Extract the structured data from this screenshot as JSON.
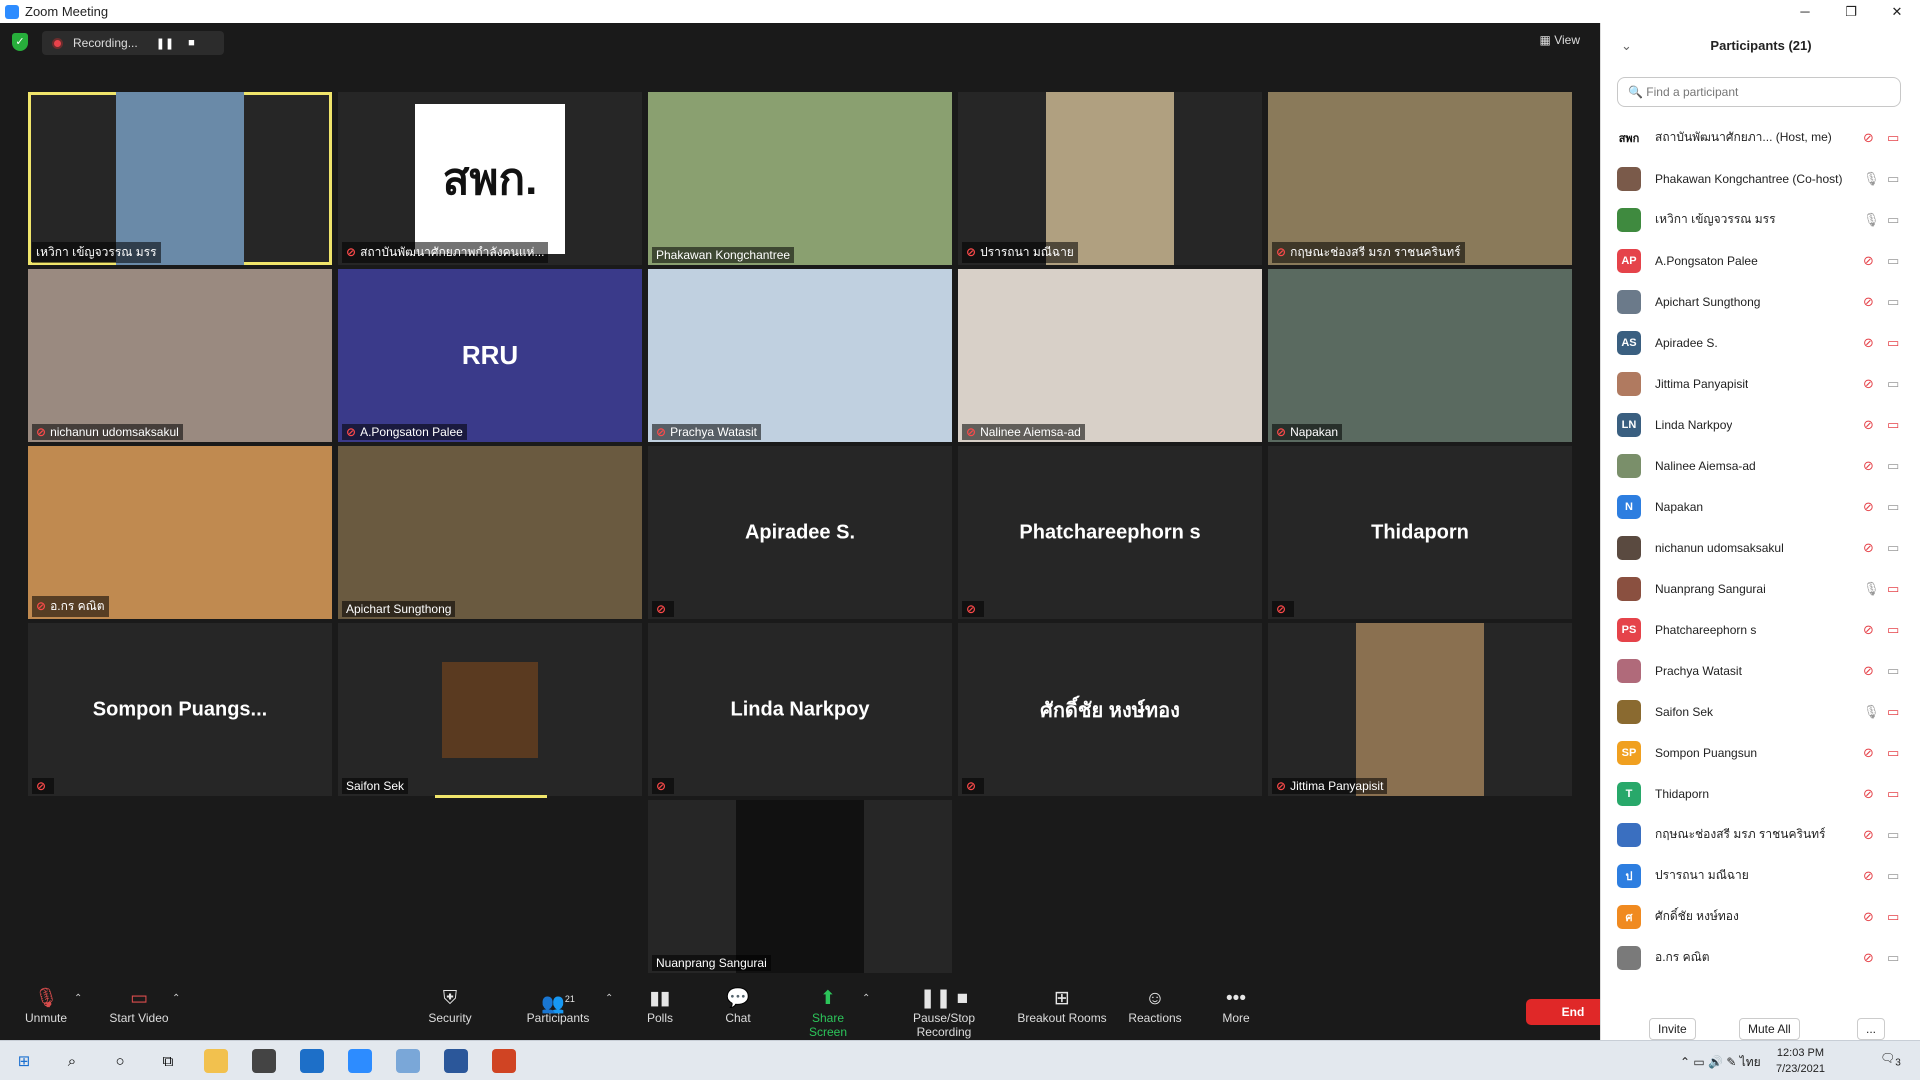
{
  "window": {
    "title": "Zoom Meeting",
    "minimize": "─",
    "restore": "❐",
    "close": "✕"
  },
  "topbar": {
    "recording_label": "Recording...",
    "pause_symbol": "❚❚",
    "stop_symbol": "■",
    "view_label": "View"
  },
  "tiles": [
    {
      "name": "เหวิกา เข้ญจวรรณ มรร",
      "muted": false,
      "video": true
    },
    {
      "name": "สถาบันพัฒนาศักยภาพกำลังคนแห่...",
      "muted": true,
      "video": true,
      "logo_text": "สพก."
    },
    {
      "name": "Phakawan Kongchantree",
      "muted": false,
      "video": true
    },
    {
      "name": "ปรารถนา มณีฉาย",
      "muted": true,
      "video": true
    },
    {
      "name": "กฤษณะช่องสรี มรภ ราชนครินทร์",
      "muted": true,
      "video": true
    },
    {
      "name": "nichanun udomsaksakul",
      "muted": true,
      "video": true
    },
    {
      "name": "A.Pongsaton Palee",
      "muted": true,
      "video": true,
      "logo_text": "RRU"
    },
    {
      "name": "Prachya Watasit",
      "muted": true,
      "video": true
    },
    {
      "name": "Nalinee Aiemsa-ad",
      "muted": true,
      "video": true
    },
    {
      "name": "Napakan",
      "muted": true,
      "video": true
    },
    {
      "name": "อ.กร คณิต",
      "muted": true,
      "video": true
    },
    {
      "name": "Apichart Sungthong",
      "muted": false,
      "video": true
    },
    {
      "name": "",
      "muted": true,
      "video": false,
      "big": "Apiradee S."
    },
    {
      "name": "",
      "muted": true,
      "video": false,
      "big": "Phatchareephorn s"
    },
    {
      "name": "",
      "muted": true,
      "video": false,
      "big": "Thidaporn"
    },
    {
      "name": "",
      "muted": true,
      "video": false,
      "big": "Sompon  Puangs..."
    },
    {
      "name": "Saifon Sek",
      "muted": false,
      "video": true
    },
    {
      "name": "",
      "muted": true,
      "video": false,
      "big": "Linda Narkpoy"
    },
    {
      "name": "",
      "muted": true,
      "video": false,
      "big": "ศักดิ์ชัย หงษ์ทอง"
    },
    {
      "name": "Jittima Panyapisit",
      "muted": true,
      "video": true
    },
    {
      "name": "Nuanprang Sangurai",
      "muted": false,
      "video": true
    }
  ],
  "toolbar": {
    "unmute": "Unmute",
    "start_video": "Start Video",
    "security": "Security",
    "participants": "Participants",
    "participants_count": "21",
    "polls": "Polls",
    "chat": "Chat",
    "share_screen": "Share Screen",
    "pause_stop_recording": "Pause/Stop Recording",
    "breakout_rooms": "Breakout Rooms",
    "reactions": "Reactions",
    "more": "More",
    "end": "End",
    "caret": "⌃"
  },
  "panel": {
    "title": "Participants (21)",
    "collapse_symbol": "⌄",
    "search_placeholder": "Find a participant",
    "participants": [
      {
        "name": "สถาบันพัฒนาศักยภา... (Host, me)",
        "initials": "สพก",
        "color": "#ffffff",
        "mic": "muted",
        "cam": "off"
      },
      {
        "name": "Phakawan Kongchantree (Co-host)",
        "initials": "",
        "color": "#7a5a4a",
        "mic": "on",
        "cam": "on"
      },
      {
        "name": "เหวิกา เข้ญจวรรณ มรร",
        "initials": "",
        "color": "#3f8a3f",
        "mic": "on",
        "cam": "on"
      },
      {
        "name": "A.Pongsaton Palee",
        "initials": "AP",
        "color": "#e5434a",
        "mic": "muted",
        "cam": "on"
      },
      {
        "name": "Apichart Sungthong",
        "initials": "",
        "color": "#6b7a8a",
        "mic": "muted",
        "cam": "on"
      },
      {
        "name": "Apiradee S.",
        "initials": "AS",
        "color": "#3a5f80",
        "mic": "muted",
        "cam": "off"
      },
      {
        "name": "Jittima Panyapisit",
        "initials": "",
        "color": "#b07a60",
        "mic": "muted",
        "cam": "on"
      },
      {
        "name": "Linda Narkpoy",
        "initials": "LN",
        "color": "#3a5f80",
        "mic": "muted",
        "cam": "off"
      },
      {
        "name": "Nalinee Aiemsa-ad",
        "initials": "",
        "color": "#7a8f6a",
        "mic": "muted",
        "cam": "on"
      },
      {
        "name": "Napakan",
        "initials": "N",
        "color": "#2d7ee0",
        "mic": "muted",
        "cam": "on"
      },
      {
        "name": "nichanun udomsaksakul",
        "initials": "",
        "color": "#5a4a40",
        "mic": "muted",
        "cam": "on"
      },
      {
        "name": "Nuanprang Sangurai",
        "initials": "",
        "color": "#8a5040",
        "mic": "on",
        "cam": "off"
      },
      {
        "name": "Phatchareephorn s",
        "initials": "PS",
        "color": "#e5434a",
        "mic": "muted",
        "cam": "off"
      },
      {
        "name": "Prachya Watasit",
        "initials": "",
        "color": "#b06a7a",
        "mic": "muted",
        "cam": "on"
      },
      {
        "name": "Saifon Sek",
        "initials": "",
        "color": "#8a6a30",
        "mic": "on",
        "cam": "off"
      },
      {
        "name": "Sompon Puangsun",
        "initials": "SP",
        "color": "#f0a020",
        "mic": "muted",
        "cam": "off"
      },
      {
        "name": "Thidaporn",
        "initials": "T",
        "color": "#28a86a",
        "mic": "muted",
        "cam": "off"
      },
      {
        "name": "กฤษณะช่องสรี มรภ ราชนครินทร์",
        "initials": "",
        "color": "#3a6fc0",
        "mic": "muted",
        "cam": "on"
      },
      {
        "name": "ปรารถนา มณีฉาย",
        "initials": "ป",
        "color": "#2d7ee0",
        "mic": "muted",
        "cam": "on"
      },
      {
        "name": "ศักดิ์ชัย หงษ์ทอง",
        "initials": "ศ",
        "color": "#f08a20",
        "mic": "muted",
        "cam": "off"
      },
      {
        "name": "อ.กร คณิต",
        "initials": "",
        "color": "#7a7a7a",
        "mic": "muted",
        "cam": "on"
      }
    ],
    "invite": "Invite",
    "mute_all": "Mute All",
    "more": "..."
  },
  "taskbar": {
    "time": "12:03 PM",
    "date": "7/23/2021",
    "lang": "ไทย",
    "notif_count": "3"
  }
}
